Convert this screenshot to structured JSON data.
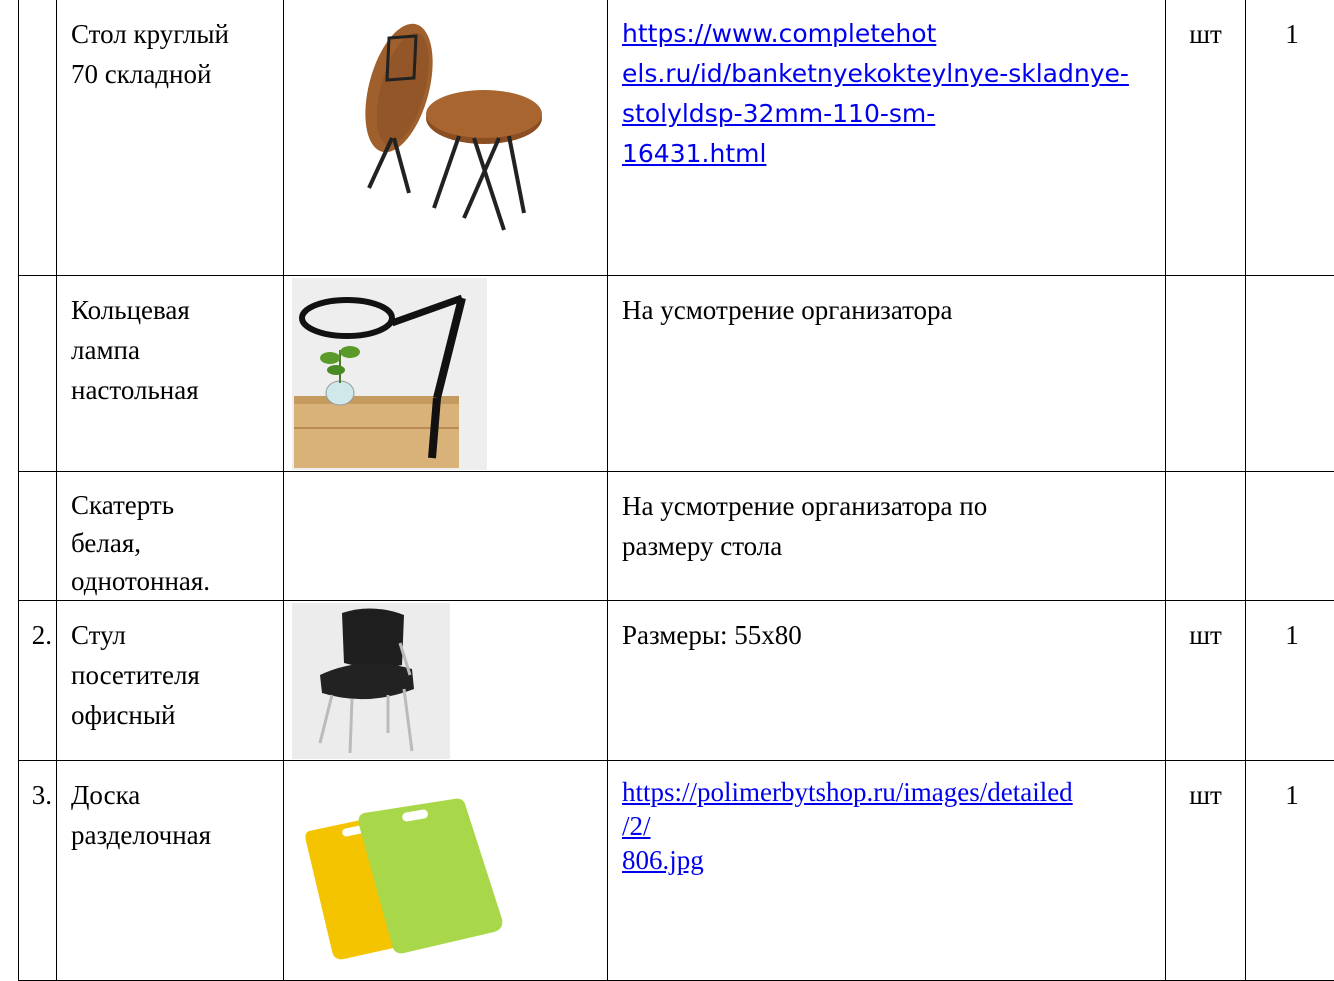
{
  "rows": [
    {
      "number": "",
      "name_lines": [
        "Стол круглый",
        "70 складной"
      ],
      "image_icon": "folding-round-table",
      "description_type": "link",
      "link_lines": [
        "https://www.completehot",
        "els.ru/id/banketnyekokteylnye-skladnye-",
        "stolyldsp-32mm-110-sm-",
        "16431.html"
      ],
      "unit": "шт",
      "qty": "1"
    },
    {
      "number": "",
      "name_lines": [
        "Кольцевая",
        "лампа",
        "настольная"
      ],
      "image_icon": "ring-lamp",
      "description_lines": [
        "На усмотрение организатора"
      ],
      "unit": "",
      "qty": ""
    },
    {
      "number": "",
      "name_lines": [
        "Скатерть",
        "белая,",
        "однотонная."
      ],
      "image_icon": "",
      "description_lines": [
        "На усмотрение организатора по",
        "размеру стола"
      ],
      "unit": "",
      "qty": ""
    },
    {
      "number": "2.",
      "name_lines": [
        "Стул",
        "посетителя",
        "офисный"
      ],
      "image_icon": "office-chair",
      "description_lines": [
        "Размеры: 55х80"
      ],
      "unit": "шт",
      "qty": "1"
    },
    {
      "number": "3.",
      "name_lines": [
        "Доска",
        "разделочная"
      ],
      "image_icon": "cutting-boards",
      "description_type": "link",
      "link_lines": [
        "https://polimerbytshop.ru/images/detailed",
        "/2/",
        "806.jpg"
      ],
      "unit": "шт",
      "qty": "1"
    }
  ],
  "colors": {
    "link": "#0000ee",
    "table_wood": "#a0602e",
    "board_yellow": "#f5c400",
    "board_green": "#a8d84a",
    "chair_black": "#1e1e1e"
  }
}
